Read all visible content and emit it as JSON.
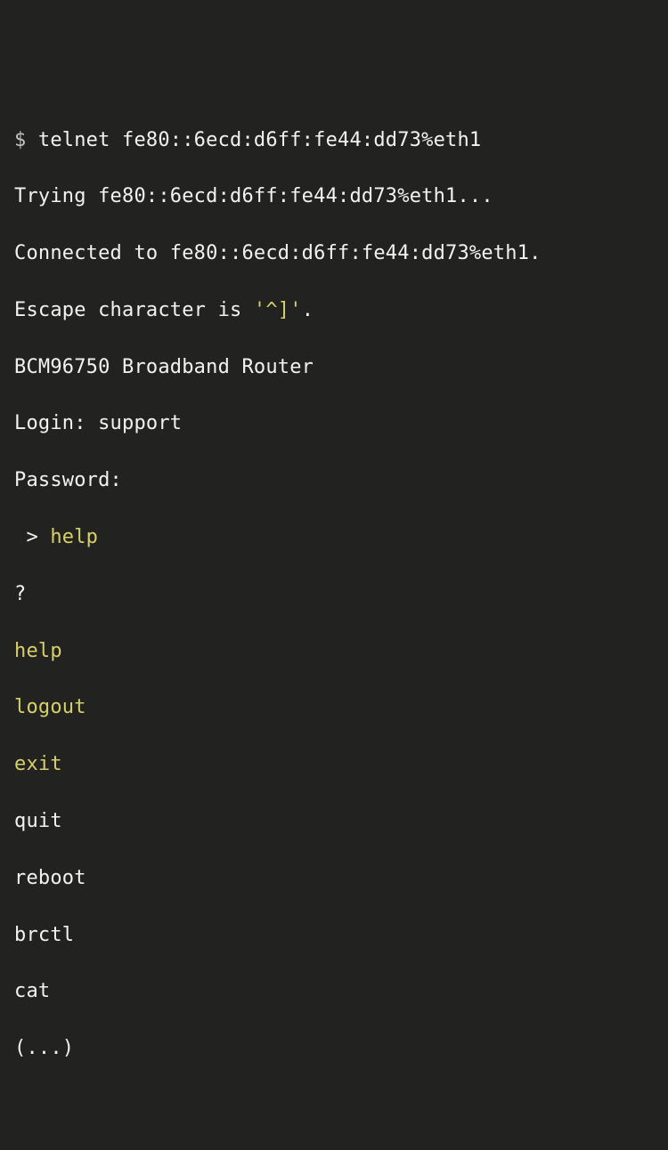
{
  "prompt": "$ ",
  "cmd_telnet": "telnet fe80::6ecd:d6ff:fe44:dd73%eth1",
  "trying": "Trying fe80::6ecd:d6ff:fe44:dd73%eth1...",
  "connected": "Connected to fe80::6ecd:d6ff:fe44:dd73%eth1.",
  "escape_prefix": "Escape character is ",
  "escape_quoted": "'^]'",
  "escape_suffix": ".",
  "banner": "BCM96750 Broadband Router",
  "login": "Login: support",
  "password": "Password:",
  "inner_prompt": " > ",
  "cmd_help": "help",
  "qmark": "?",
  "help_label": "help",
  "logout": "logout",
  "exit": "exit",
  "quit": "quit",
  "reboot": "reboot",
  "brctl": "brctl",
  "cat": "cat",
  "ellipsis": "(...)"
}
